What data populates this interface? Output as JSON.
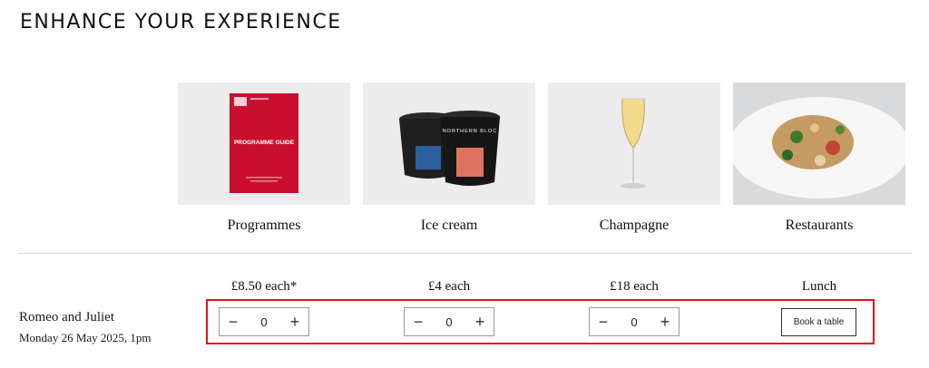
{
  "page": {
    "title": "ENHANCE YOUR EXPERIENCE"
  },
  "products": [
    {
      "label": "Programmes",
      "price": "£8.50 each*",
      "image": "programme-guide-image",
      "brochure_text": "PROGRAMME GUIDE",
      "quantity": "0"
    },
    {
      "label": "Ice cream",
      "price": "£4 each",
      "image": "ice-cream-tubs-image",
      "brand_text": "NORTHERN BLOC",
      "quantity": "0"
    },
    {
      "label": "Champagne",
      "price": "£18 each",
      "image": "champagne-flute-image",
      "quantity": "0"
    },
    {
      "label": "Restaurants",
      "price": "Lunch",
      "image": "restaurant-dish-image",
      "action": "Book a table"
    }
  ],
  "event": {
    "name": "Romeo and Juliet",
    "date": "Monday 26 May 2025, 1pm"
  },
  "stepper": {
    "minus": "−",
    "plus": "+"
  },
  "colors": {
    "highlight": "#e3101a",
    "programme_red": "#c8102e",
    "card_bg": "#ececec"
  }
}
